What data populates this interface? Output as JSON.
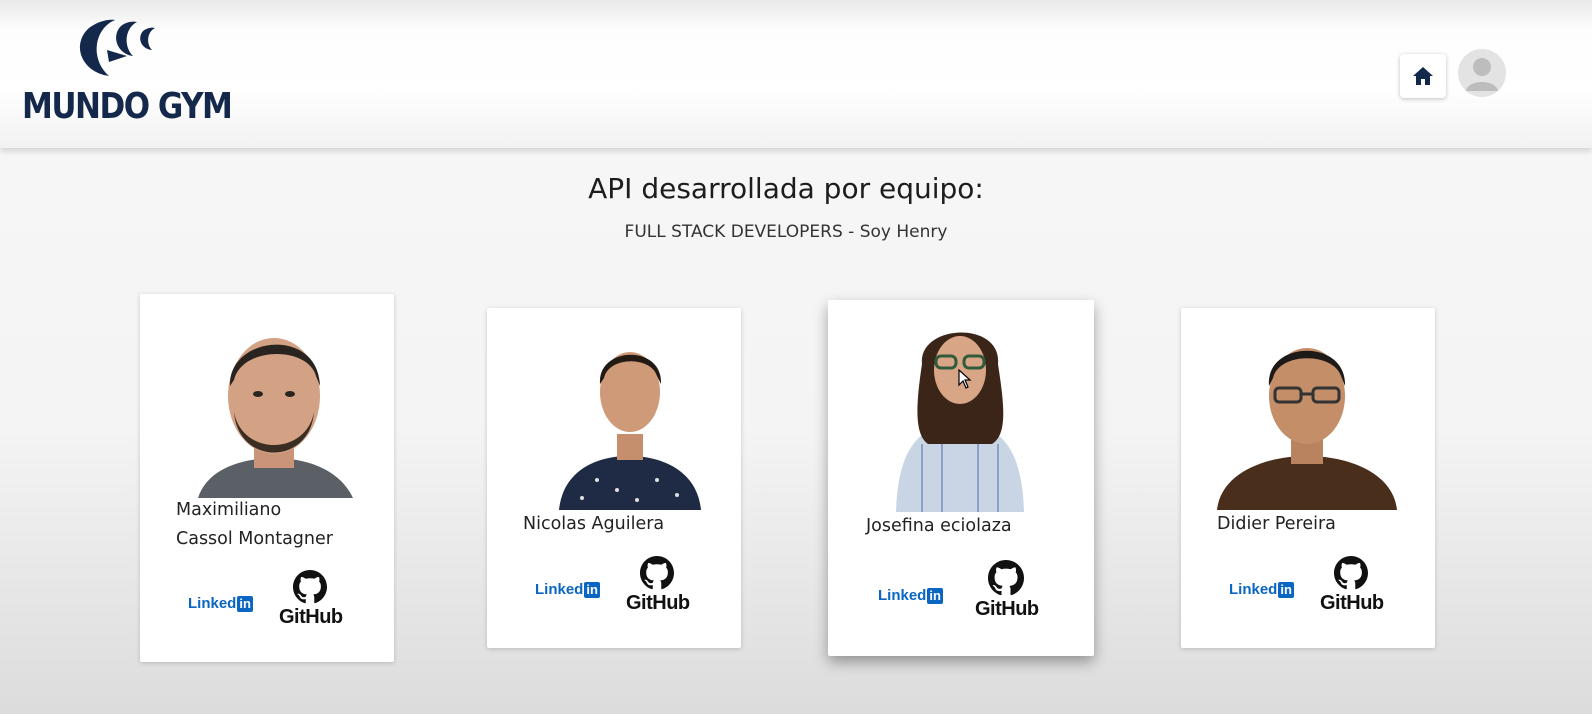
{
  "header": {
    "logo_text": "MUNDO GYM",
    "home_icon": "home-icon",
    "avatar_icon": "user-avatar-icon"
  },
  "main": {
    "title": "API desarrollada por equipo:",
    "subtitle": "FULL STACK DEVELOPERS - Soy Henry"
  },
  "team": [
    {
      "name_line1": "Maximiliano",
      "name_line2": "Cassol Montagner",
      "linkedin": "Linked",
      "linkedin_in": "in",
      "github": "GitHub"
    },
    {
      "name_line1": "Nicolas Aguilera",
      "linkedin": "Linked",
      "linkedin_in": "in",
      "github": "GitHub"
    },
    {
      "name_line1": "Josefina eciolaza",
      "linkedin": "Linked",
      "linkedin_in": "in",
      "github": "GitHub"
    },
    {
      "name_line1": "Didier Pereira",
      "linkedin": "Linked",
      "linkedin_in": "in",
      "github": "GitHub"
    }
  ],
  "colors": {
    "brand": "#14284b",
    "linkedin": "#0a66c2"
  }
}
